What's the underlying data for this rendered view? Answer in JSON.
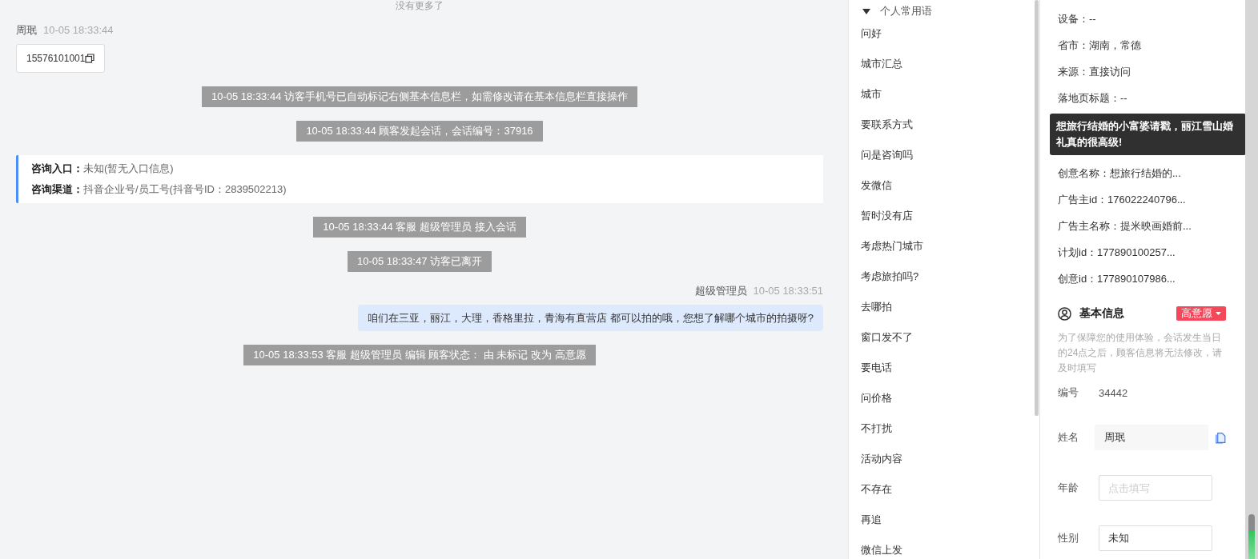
{
  "chat": {
    "no_more": "没有更多了",
    "messages": [
      {
        "kind": "visitor",
        "name": "周珉",
        "time": "10-05 18:33:44",
        "text": "15576101001"
      },
      {
        "kind": "system",
        "text": "10-05 18:33:44 访客手机号已自动标记右侧基本信息栏，如需修改请在基本信息栏直接操作"
      },
      {
        "kind": "system",
        "text": "10-05 18:33:44 顾客发起会话，会话编号：37916"
      },
      {
        "kind": "entry",
        "rows": [
          {
            "label": "咨询入口：",
            "value": "未知(暂无入口信息)"
          },
          {
            "label": "咨询渠道：",
            "value": "抖音企业号/员工号(抖音号ID：2839502213)"
          }
        ]
      },
      {
        "kind": "system",
        "text": "10-05 18:33:44 客服 超级管理员 接入会话"
      },
      {
        "kind": "system",
        "text": "10-05 18:33:47 访客已离开"
      },
      {
        "kind": "agent",
        "name": "超级管理员",
        "time": "10-05 18:33:51",
        "text": "咱们在三亚，丽江，大理，香格里拉，青海有直营店 都可以拍的哦，您想了解哪个城市的拍摄呀?"
      },
      {
        "kind": "system",
        "text": "10-05 18:33:53 客服 超级管理员 编辑 顾客状态： 由 未标记 改为 高意愿"
      }
    ]
  },
  "phrases": {
    "title": "个人常用语",
    "expanded": true,
    "items": [
      "问好",
      "城市汇总",
      "城市",
      "要联系方式",
      "问是咨询吗",
      "发微信",
      "暂时没有店",
      "考虑热门城市",
      "考虑旅拍吗?",
      "去哪拍",
      "窗口发不了",
      "要电话",
      "问价格",
      "不打扰",
      "活动内容",
      "不存在",
      "再追",
      "微信上发"
    ]
  },
  "info": {
    "rows": [
      {
        "text": "设备：--"
      },
      {
        "text": "省市：湖南，常德"
      },
      {
        "text": "来源：直接访问"
      },
      {
        "text": "落地页标题：--"
      },
      {
        "text": "创意名称：想旅行结婚的..."
      },
      {
        "text": "广告主id：176022240796..."
      },
      {
        "text": "广告主名称：提米映画婚前..."
      },
      {
        "text": "计划id：177890100257..."
      },
      {
        "text": "创意id：177890107986..."
      }
    ],
    "tooltip": "想旅行结婚的小富婆请戳，丽江雪山婚礼真的很高级!",
    "basic": {
      "title": "基本信息",
      "intent": "高意愿",
      "notice": "为了保障您的使用体验，会话发生当日的24点之后，顾客信息将无法修改，请及时填写",
      "fields": [
        {
          "kind": "readonly",
          "label": "编号",
          "value": "34442"
        },
        {
          "kind": "input",
          "label": "姓名",
          "value": "周珉",
          "disabled": true,
          "copy": true
        },
        {
          "kind": "input",
          "label": "年龄",
          "placeholder": "点击填写",
          "disabled": false,
          "copy": false
        },
        {
          "kind": "input",
          "label": "性别",
          "value": "未知",
          "disabled": false,
          "copy": false
        }
      ]
    }
  }
}
